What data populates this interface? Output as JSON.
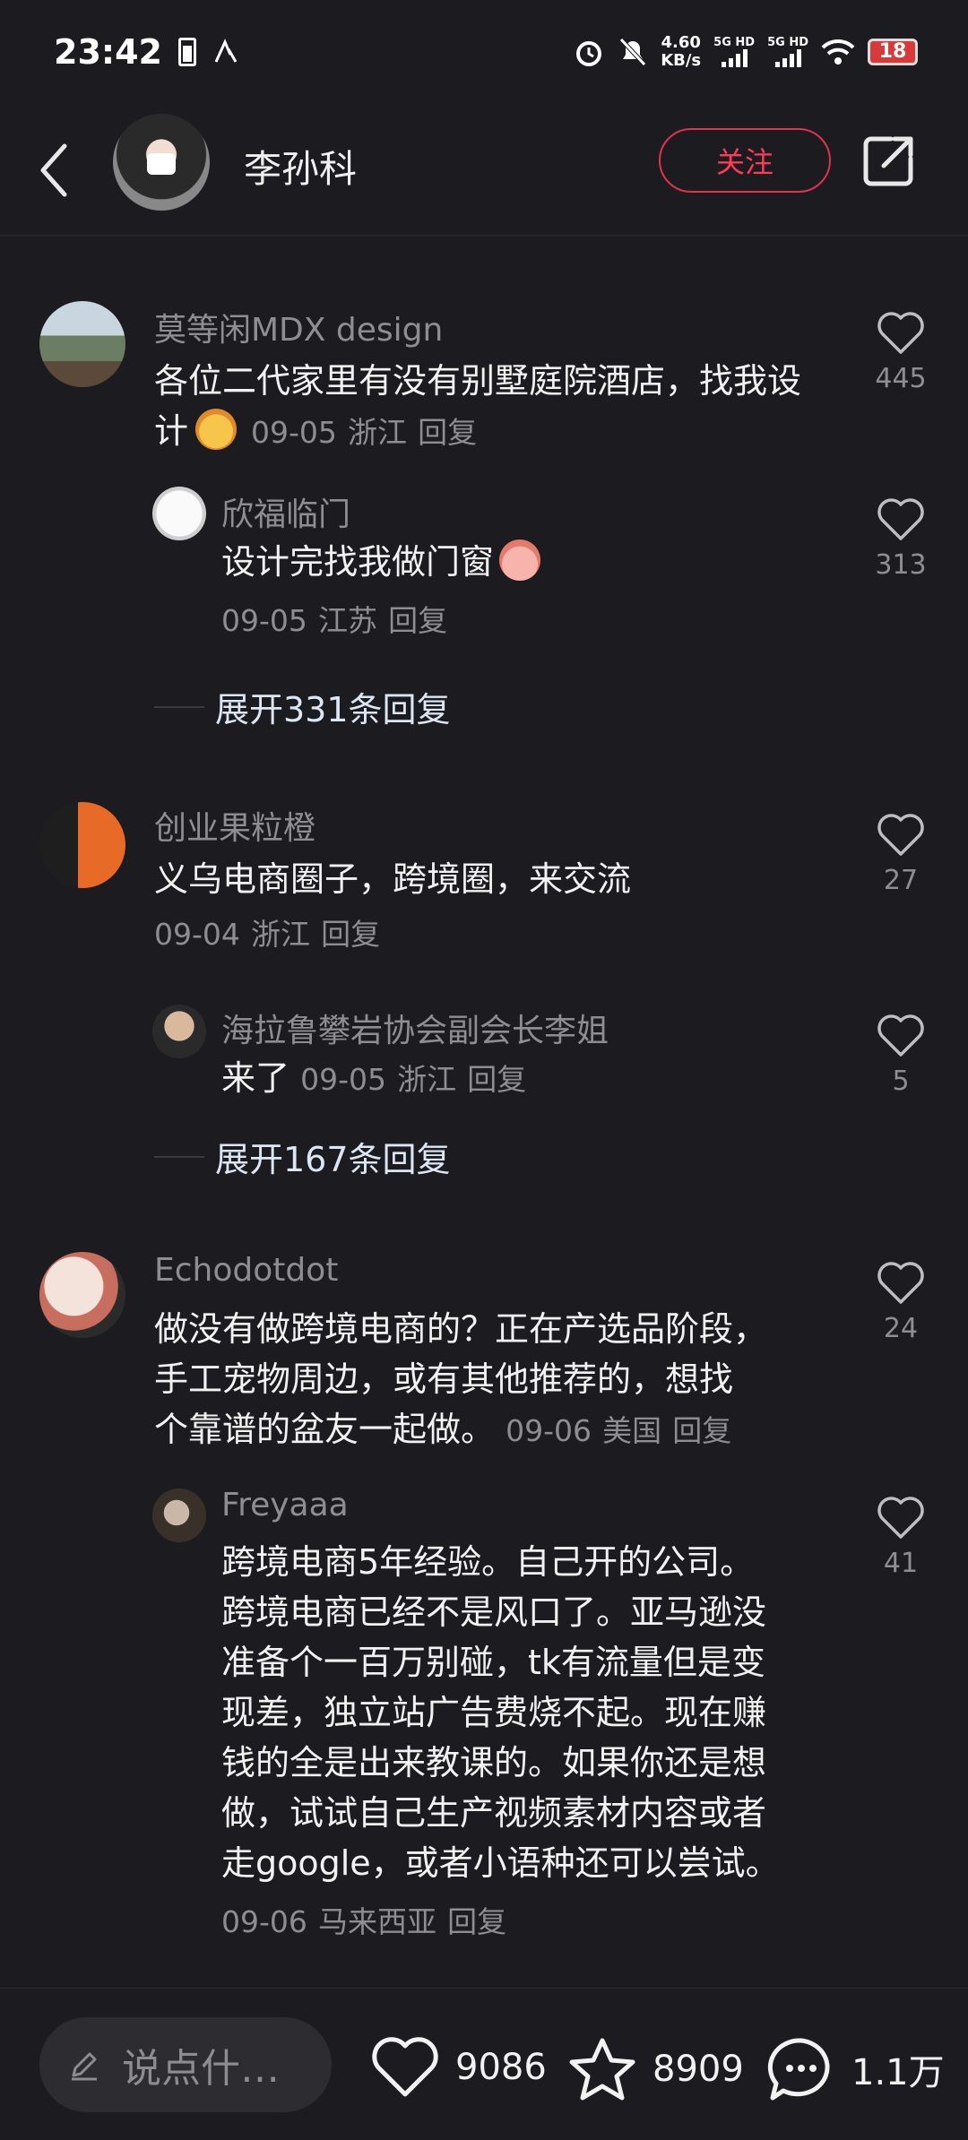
{
  "status": {
    "time": "23:42",
    "speed_top": "4.60",
    "speed_bottom": "KB/s",
    "sim1": "5G HD",
    "sim2": "5G HD",
    "battery": "18"
  },
  "header": {
    "name": "李孙科",
    "follow_label": "关注"
  },
  "comments": [
    {
      "user": "莫等闲MDX design",
      "text": "各位二代家里有没有别墅庭院酒店，找我设计",
      "date": "09-05",
      "region": "浙江",
      "reply_label": "回复",
      "likes": "445",
      "replies": [
        {
          "user": "欣福临门",
          "text": "设计完找我做门窗",
          "date": "09-05",
          "region": "江苏",
          "reply_label": "回复",
          "likes": "313"
        }
      ],
      "expand_label": "展开331条回复"
    },
    {
      "user": "创业果粒橙",
      "text": "义乌电商圈子，跨境圈，来交流",
      "date": "09-04",
      "region": "浙江",
      "reply_label": "回复",
      "likes": "27",
      "replies": [
        {
          "user": "海拉鲁攀岩协会副会长李姐",
          "text": "来了",
          "date": "09-05",
          "region": "浙江",
          "reply_label": "回复",
          "likes": "5"
        }
      ],
      "expand_label": "展开167条回复"
    },
    {
      "user": "Echodotdot",
      "text_lines": [
        "做没有做跨境电商的？正在产选品阶段，",
        "手工宠物周边，或有其他推荐的，想找",
        "个靠谱的盆友一起做。"
      ],
      "date": "09-06",
      "region": "美国",
      "reply_label": "回复",
      "likes": "24",
      "replies": [
        {
          "user": "Freyaaa",
          "text_lines": [
            "跨境电商5年经验。自己开的公司。",
            "跨境电商已经不是风口了。亚马逊没",
            "准备个一百万别碰，tk有流量但是变",
            "现差，独立站广告费烧不起。现在赚",
            "钱的全是出来教课的。如果你还是想",
            "做，试试自己生产视频素材内容或者",
            "走google，或者小语种还可以尝试。"
          ],
          "date": "09-06",
          "region": "马来西亚",
          "reply_label": "回复",
          "likes": "41"
        }
      ]
    }
  ],
  "bottom": {
    "placeholder": "说点什…",
    "likes": "9086",
    "favorites": "8909",
    "comments": "1.1万"
  }
}
